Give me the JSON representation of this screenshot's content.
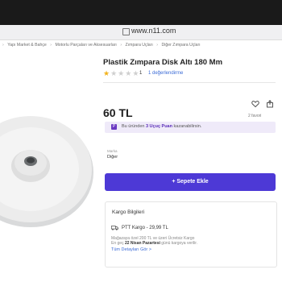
{
  "browser": {
    "url": "www.n11.com"
  },
  "breadcrumb": [
    "Yapı Market & Bahçe",
    "Motorlu Parçaları ve Aksesuarları",
    "Zımpara Uçları",
    "Diğer Zımpara Uçları"
  ],
  "product": {
    "title": "Plastik Zımpara Disk Altı 180 Mm",
    "rating": 1,
    "rating_max": 5,
    "rating_label": "1",
    "reviews_label": "1 değerlendirme",
    "price": "60 TL",
    "favorites": "2 favori",
    "brand_label": "Marka",
    "brand_value": "Diğer"
  },
  "points": {
    "badge": "P",
    "prefix": "Bu üründen ",
    "amount": "3 Uçuç Puan",
    "suffix": " kazanabilirsin."
  },
  "cart": {
    "label": "+ Sepete Ekle"
  },
  "shipping": {
    "title": "Kargo Bilgileri",
    "carrier": "PTT Kargo - 29,99 TL",
    "note": "Mağazaya özel 200 TL ve üzeri Ücretsiz Kargo",
    "date_prefix": "En geç ",
    "date": "22 Nisan Pazartesi",
    "date_suffix": " günü kargoya verilir.",
    "details_link": "Tüm Detayları Gör >"
  },
  "icons": [
    "lock-icon",
    "star-icon",
    "heart-icon",
    "share-icon",
    "truck-icon"
  ],
  "colors": {
    "accent": "#4d39d6",
    "points_bg": "#efeaf9",
    "star": "#f2b21b",
    "link": "#3b6bd6"
  }
}
